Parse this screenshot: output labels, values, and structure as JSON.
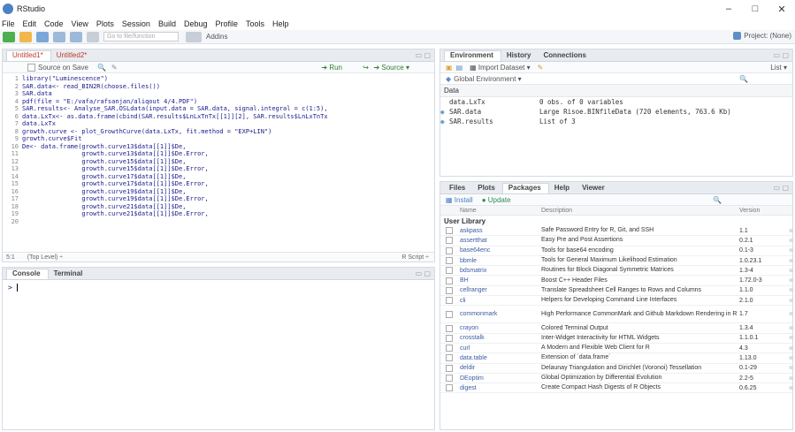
{
  "window": {
    "title": "RStudio",
    "controls": [
      "–",
      "□",
      "✕"
    ]
  },
  "menu": [
    "File",
    "Edit",
    "Code",
    "View",
    "Plots",
    "Session",
    "Build",
    "Debug",
    "Profile",
    "Tools",
    "Help"
  ],
  "toolbar": {
    "goto_placeholder": "Go to file/function",
    "addins": "Addins",
    "project": "Project: (None)"
  },
  "source": {
    "tabs": [
      "Untitled1*",
      "Untitled2*"
    ],
    "source_on_save": "Source on Save",
    "run": "Run",
    "source": "Source",
    "lines": [
      {
        "n": "1",
        "t": "library(\"Luminescence\")"
      },
      {
        "n": "2",
        "t": "SAR.data<- read_BIN2R(choose.files())"
      },
      {
        "n": "3",
        "t": "SAR.data"
      },
      {
        "n": "4",
        "t": "pdf(file = \"E:/vafa/rafsanjan/aliqout 4/4.PDF\")"
      },
      {
        "n": "5",
        "t": "SAR.results<- Analyse_SAR.OSLdata(input.data = SAR.data, signal.integral = c(1:5),"
      },
      {
        "n": "6",
        "t": "data.LxTx<- as.data.frame(cbind(SAR.results$LnLxTnTx[[1]][2], SAR.results$LnLxTnTx"
      },
      {
        "n": "7",
        "t": "data.LxTx"
      },
      {
        "n": "8",
        "t": "growth.curve <- plot_GrowthCurve(data.LxTx, fit.method = \"EXP+LIN\")"
      },
      {
        "n": "9",
        "t": "growth.curve$Fit"
      },
      {
        "n": "10",
        "t": "De<- data.frame(growth.curve13$data[[1]]$De,"
      },
      {
        "n": "11",
        "t": "                growth.curve13$data[[1]]$De.Error,"
      },
      {
        "n": "12",
        "t": "                growth.curve15$data[[1]]$De,"
      },
      {
        "n": "13",
        "t": "                growth.curve15$data[[1]]$De.Error,"
      },
      {
        "n": "14",
        "t": "                growth.curve17$data[[1]]$De,"
      },
      {
        "n": "15",
        "t": "                growth.curve17$data[[1]]$De.Error,"
      },
      {
        "n": "16",
        "t": "                growth.curve19$data[[1]]$De,"
      },
      {
        "n": "17",
        "t": "                growth.curve19$data[[1]]$De.Error,"
      },
      {
        "n": "18",
        "t": "                growth.curve21$data[[1]]$De,"
      },
      {
        "n": "19",
        "t": "                growth.curve21$data[[1]]$De.Error,"
      },
      {
        "n": "20",
        "t": ""
      }
    ],
    "status_pos": "5:1",
    "status_scope": "(Top Level) ÷",
    "status_type": "R Script ÷"
  },
  "console": {
    "tabs": [
      "Console",
      "Terminal"
    ],
    "prompt": ">"
  },
  "environment": {
    "tabs": [
      "Environment",
      "History",
      "Connections"
    ],
    "import": "Import Dataset",
    "list": "List",
    "global": "Global Environment",
    "section": "Data",
    "rows": [
      {
        "name": "data.LxTx",
        "value": "0 obs. of 0 variables"
      },
      {
        "name": "SAR.data",
        "value": "Large Risoe.BINfileData (720 elements, 763.6 Kb)"
      },
      {
        "name": "SAR.results",
        "value": "List of 3"
      }
    ]
  },
  "files": {
    "tabs": [
      "Files",
      "Plots",
      "Packages",
      "Help",
      "Viewer"
    ],
    "install": "Install",
    "update": "Update",
    "headers": [
      "Name",
      "Description",
      "Version"
    ],
    "section": "User Library",
    "packages": [
      {
        "name": "askpass",
        "desc": "Safe Password Entry for R, Git, and SSH",
        "ver": "1.1"
      },
      {
        "name": "assertthat",
        "desc": "Easy Pre and Post Assertions",
        "ver": "0.2.1"
      },
      {
        "name": "base64enc",
        "desc": "Tools for base64 encoding",
        "ver": "0.1-3"
      },
      {
        "name": "bbmle",
        "desc": "Tools for General Maximum Likelihood Estimation",
        "ver": "1.0.23.1"
      },
      {
        "name": "bdsmatrix",
        "desc": "Routines for Block Diagonal Symmetric Matrices",
        "ver": "1.3-4"
      },
      {
        "name": "BH",
        "desc": "Boost C++ Header Files",
        "ver": "1.72.0-3"
      },
      {
        "name": "cellranger",
        "desc": "Translate Spreadsheet Cell Ranges to Rows and Columns",
        "ver": "1.1.0"
      },
      {
        "name": "cli",
        "desc": "Helpers for Developing Command Line Interfaces",
        "ver": "2.1.0"
      },
      {
        "name": "commonmark",
        "desc": "High Performance CommonMark and Github Markdown Rendering in R",
        "ver": "1.7"
      },
      {
        "name": "crayon",
        "desc": "Colored Terminal Output",
        "ver": "1.3.4"
      },
      {
        "name": "crosstalk",
        "desc": "Inter-Widget Interactivity for HTML Widgets",
        "ver": "1.1.0.1"
      },
      {
        "name": "curl",
        "desc": "A Modern and Flexible Web Client for R",
        "ver": "4.3"
      },
      {
        "name": "data.table",
        "desc": "Extension of `data.frame`",
        "ver": "1.13.0"
      },
      {
        "name": "deldir",
        "desc": "Delaunay Triangulation and Dirichlet (Voronoi) Tessellation",
        "ver": "0.1-29"
      },
      {
        "name": "DEoptim",
        "desc": "Global Optimization by Differential Evolution",
        "ver": "2.2-5"
      },
      {
        "name": "digest",
        "desc": "Create Compact Hash Digests of R Objects",
        "ver": "0.6.25"
      }
    ]
  }
}
